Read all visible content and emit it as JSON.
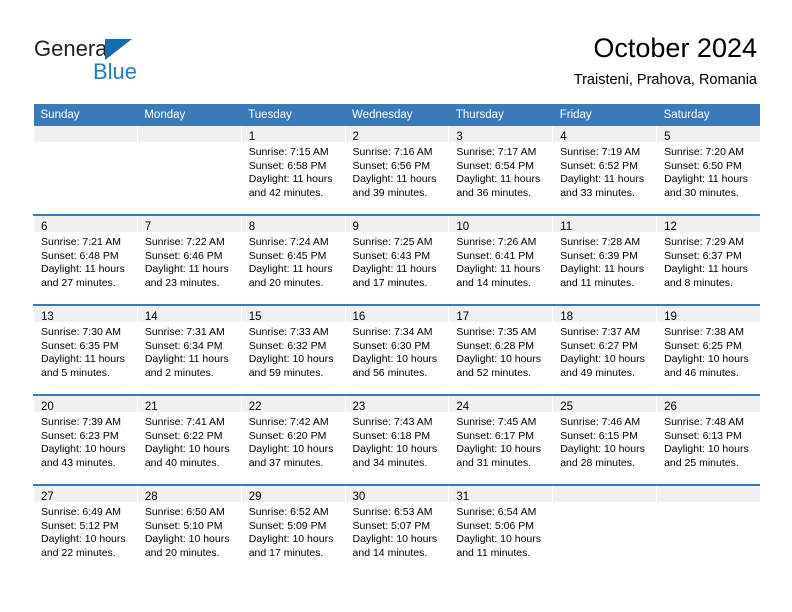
{
  "brand": {
    "name_part1": "General",
    "name_part2": "Blue",
    "triangle_color": "#176bb0",
    "blue_color": "#1a7fd4"
  },
  "header": {
    "title": "October 2024",
    "subtitle": "Traisteni, Prahova, Romania"
  },
  "theme": {
    "header_blue": "#3a79ba",
    "daynum_band": "#f0f0f0",
    "cell_bg": "#ffffff"
  },
  "weekday_headers": [
    "Sunday",
    "Monday",
    "Tuesday",
    "Wednesday",
    "Thursday",
    "Friday",
    "Saturday"
  ],
  "weeks": [
    [
      {
        "day": "",
        "lines": []
      },
      {
        "day": "",
        "lines": []
      },
      {
        "day": "1",
        "lines": [
          "Sunrise: 7:15 AM",
          "Sunset: 6:58 PM",
          "Daylight: 11 hours",
          "and 42 minutes."
        ]
      },
      {
        "day": "2",
        "lines": [
          "Sunrise: 7:16 AM",
          "Sunset: 6:56 PM",
          "Daylight: 11 hours",
          "and 39 minutes."
        ]
      },
      {
        "day": "3",
        "lines": [
          "Sunrise: 7:17 AM",
          "Sunset: 6:54 PM",
          "Daylight: 11 hours",
          "and 36 minutes."
        ]
      },
      {
        "day": "4",
        "lines": [
          "Sunrise: 7:19 AM",
          "Sunset: 6:52 PM",
          "Daylight: 11 hours",
          "and 33 minutes."
        ]
      },
      {
        "day": "5",
        "lines": [
          "Sunrise: 7:20 AM",
          "Sunset: 6:50 PM",
          "Daylight: 11 hours",
          "and 30 minutes."
        ]
      }
    ],
    [
      {
        "day": "6",
        "lines": [
          "Sunrise: 7:21 AM",
          "Sunset: 6:48 PM",
          "Daylight: 11 hours",
          "and 27 minutes."
        ]
      },
      {
        "day": "7",
        "lines": [
          "Sunrise: 7:22 AM",
          "Sunset: 6:46 PM",
          "Daylight: 11 hours",
          "and 23 minutes."
        ]
      },
      {
        "day": "8",
        "lines": [
          "Sunrise: 7:24 AM",
          "Sunset: 6:45 PM",
          "Daylight: 11 hours",
          "and 20 minutes."
        ]
      },
      {
        "day": "9",
        "lines": [
          "Sunrise: 7:25 AM",
          "Sunset: 6:43 PM",
          "Daylight: 11 hours",
          "and 17 minutes."
        ]
      },
      {
        "day": "10",
        "lines": [
          "Sunrise: 7:26 AM",
          "Sunset: 6:41 PM",
          "Daylight: 11 hours",
          "and 14 minutes."
        ]
      },
      {
        "day": "11",
        "lines": [
          "Sunrise: 7:28 AM",
          "Sunset: 6:39 PM",
          "Daylight: 11 hours",
          "and 11 minutes."
        ]
      },
      {
        "day": "12",
        "lines": [
          "Sunrise: 7:29 AM",
          "Sunset: 6:37 PM",
          "Daylight: 11 hours",
          "and 8 minutes."
        ]
      }
    ],
    [
      {
        "day": "13",
        "lines": [
          "Sunrise: 7:30 AM",
          "Sunset: 6:35 PM",
          "Daylight: 11 hours",
          "and 5 minutes."
        ]
      },
      {
        "day": "14",
        "lines": [
          "Sunrise: 7:31 AM",
          "Sunset: 6:34 PM",
          "Daylight: 11 hours",
          "and 2 minutes."
        ]
      },
      {
        "day": "15",
        "lines": [
          "Sunrise: 7:33 AM",
          "Sunset: 6:32 PM",
          "Daylight: 10 hours",
          "and 59 minutes."
        ]
      },
      {
        "day": "16",
        "lines": [
          "Sunrise: 7:34 AM",
          "Sunset: 6:30 PM",
          "Daylight: 10 hours",
          "and 56 minutes."
        ]
      },
      {
        "day": "17",
        "lines": [
          "Sunrise: 7:35 AM",
          "Sunset: 6:28 PM",
          "Daylight: 10 hours",
          "and 52 minutes."
        ]
      },
      {
        "day": "18",
        "lines": [
          "Sunrise: 7:37 AM",
          "Sunset: 6:27 PM",
          "Daylight: 10 hours",
          "and 49 minutes."
        ]
      },
      {
        "day": "19",
        "lines": [
          "Sunrise: 7:38 AM",
          "Sunset: 6:25 PM",
          "Daylight: 10 hours",
          "and 46 minutes."
        ]
      }
    ],
    [
      {
        "day": "20",
        "lines": [
          "Sunrise: 7:39 AM",
          "Sunset: 6:23 PM",
          "Daylight: 10 hours",
          "and 43 minutes."
        ]
      },
      {
        "day": "21",
        "lines": [
          "Sunrise: 7:41 AM",
          "Sunset: 6:22 PM",
          "Daylight: 10 hours",
          "and 40 minutes."
        ]
      },
      {
        "day": "22",
        "lines": [
          "Sunrise: 7:42 AM",
          "Sunset: 6:20 PM",
          "Daylight: 10 hours",
          "and 37 minutes."
        ]
      },
      {
        "day": "23",
        "lines": [
          "Sunrise: 7:43 AM",
          "Sunset: 6:18 PM",
          "Daylight: 10 hours",
          "and 34 minutes."
        ]
      },
      {
        "day": "24",
        "lines": [
          "Sunrise: 7:45 AM",
          "Sunset: 6:17 PM",
          "Daylight: 10 hours",
          "and 31 minutes."
        ]
      },
      {
        "day": "25",
        "lines": [
          "Sunrise: 7:46 AM",
          "Sunset: 6:15 PM",
          "Daylight: 10 hours",
          "and 28 minutes."
        ]
      },
      {
        "day": "26",
        "lines": [
          "Sunrise: 7:48 AM",
          "Sunset: 6:13 PM",
          "Daylight: 10 hours",
          "and 25 minutes."
        ]
      }
    ],
    [
      {
        "day": "27",
        "lines": [
          "Sunrise: 6:49 AM",
          "Sunset: 5:12 PM",
          "Daylight: 10 hours",
          "and 22 minutes."
        ]
      },
      {
        "day": "28",
        "lines": [
          "Sunrise: 6:50 AM",
          "Sunset: 5:10 PM",
          "Daylight: 10 hours",
          "and 20 minutes."
        ]
      },
      {
        "day": "29",
        "lines": [
          "Sunrise: 6:52 AM",
          "Sunset: 5:09 PM",
          "Daylight: 10 hours",
          "and 17 minutes."
        ]
      },
      {
        "day": "30",
        "lines": [
          "Sunrise: 6:53 AM",
          "Sunset: 5:07 PM",
          "Daylight: 10 hours",
          "and 14 minutes."
        ]
      },
      {
        "day": "31",
        "lines": [
          "Sunrise: 6:54 AM",
          "Sunset: 5:06 PM",
          "Daylight: 10 hours",
          "and 11 minutes."
        ]
      },
      {
        "day": "",
        "lines": []
      },
      {
        "day": "",
        "lines": []
      }
    ]
  ]
}
